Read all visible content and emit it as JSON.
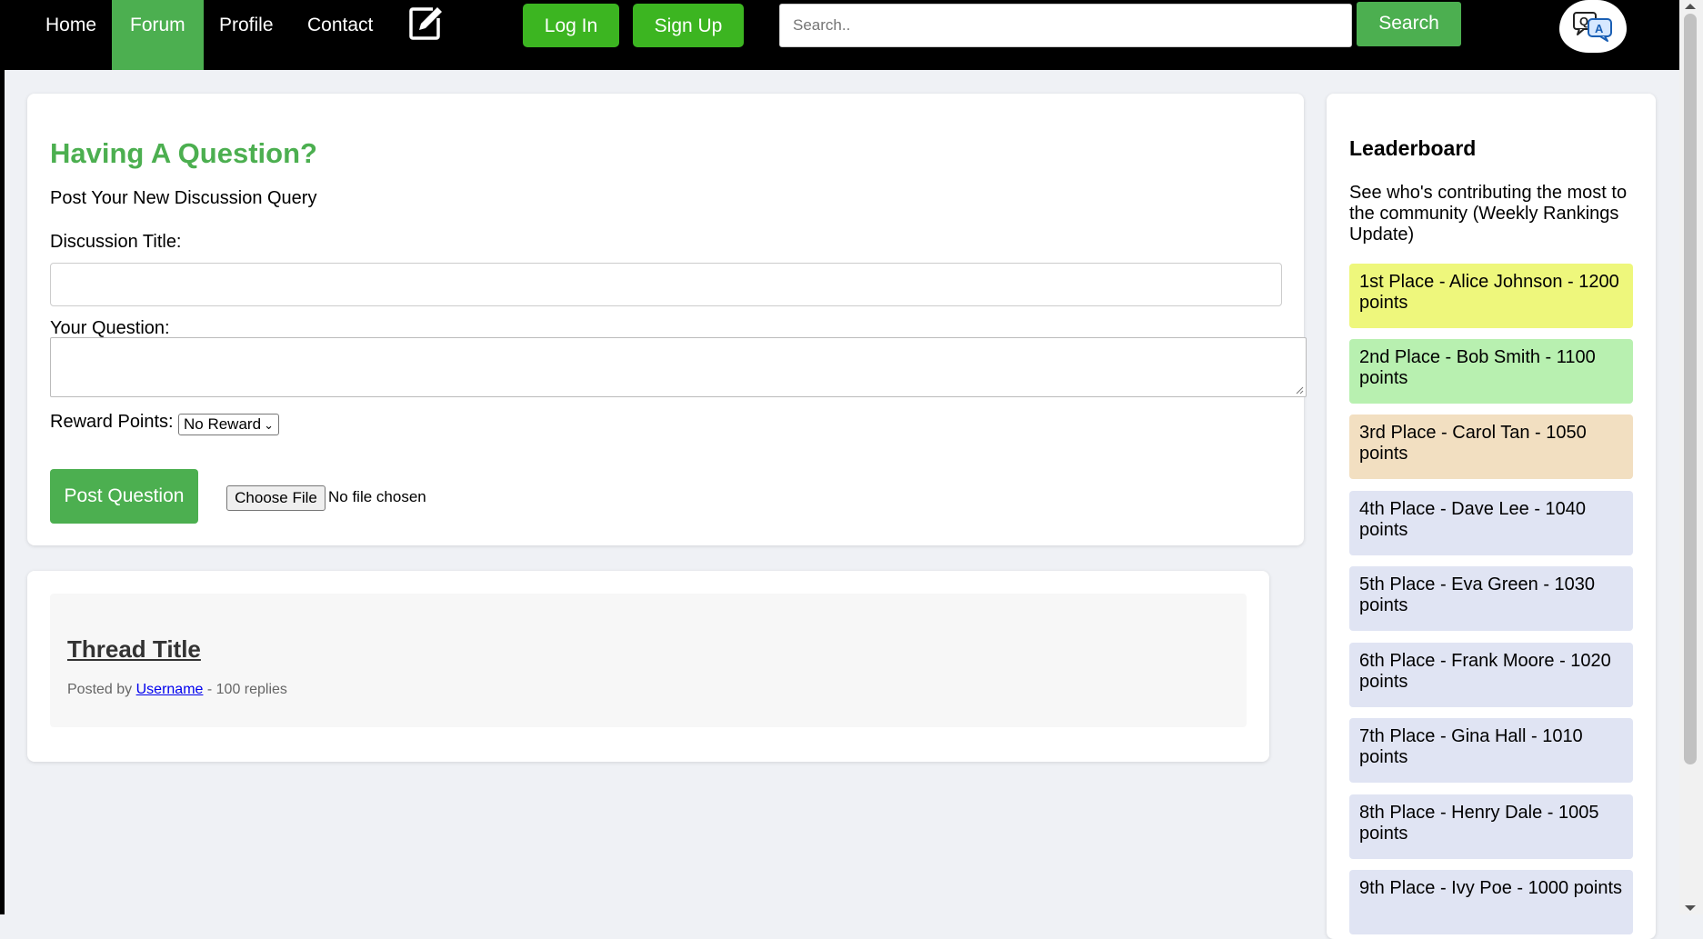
{
  "nav": {
    "links": [
      {
        "label": "Home",
        "active": false
      },
      {
        "label": "Forum",
        "active": true
      },
      {
        "label": "Profile",
        "active": false
      },
      {
        "label": "Contact",
        "active": false
      }
    ],
    "login_label": "Log In",
    "signup_label": "Sign Up",
    "search_placeholder": "Search..",
    "search_button": "Search",
    "edit_icon": "edit-icon",
    "logo_icon": "qa-chat-logo"
  },
  "colors": {
    "accent": "#4caf50",
    "nav_button": "#3cb521",
    "gold": "#eef77c",
    "silver": "#b8f0b0",
    "bronze": "#f2dfc1",
    "default_rank": "#e0e4f3"
  },
  "post_form": {
    "title": "Having A Question?",
    "subtitle": "Post Your New Discussion Query",
    "title_label": "Discussion Title:",
    "question_label": "Your Question:",
    "reward_label": "Reward Points:",
    "reward_selected": "No Reward",
    "post_button": "Post Question",
    "file_button": "Choose File",
    "file_status": "No file chosen"
  },
  "thread": {
    "title": "Thread Title",
    "posted_by": "Posted by",
    "username": "Username",
    "replies": "- 100 replies"
  },
  "leaderboard": {
    "title": "Leaderboard",
    "description": "See who's contributing the most to the community (Weekly Rankings Update)",
    "entries": [
      "1st Place - Alice Johnson - 1200 points",
      "2nd Place - Bob Smith - 1100 points",
      "3rd Place - Carol Tan - 1050 points",
      "4th Place - Dave Lee - 1040 points",
      "5th Place - Eva Green - 1030 points",
      "6th Place - Frank Moore - 1020 points",
      "7th Place - Gina Hall - 1010 points",
      "8th Place - Henry Dale - 1005 points",
      "9th Place - Ivy Poe - 1000 points"
    ]
  }
}
